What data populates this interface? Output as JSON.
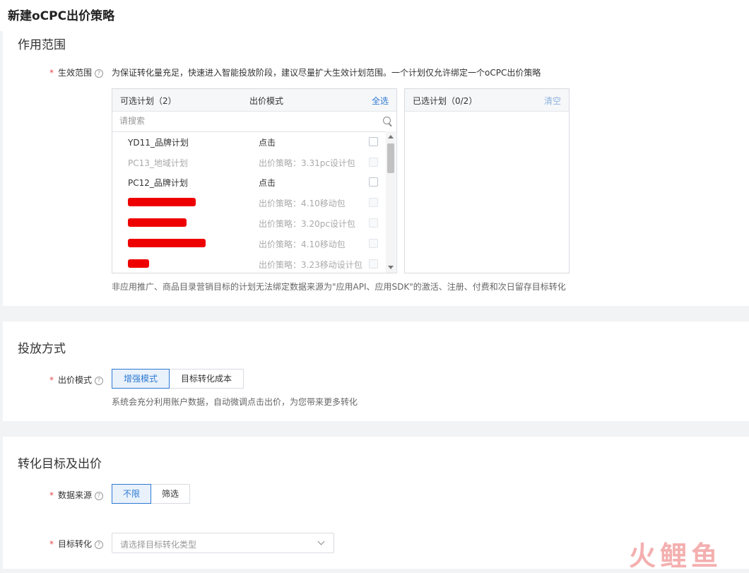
{
  "page": {
    "title": "新建oCPC出价策略"
  },
  "scope": {
    "section_title": "作用范围",
    "field_label": "生效范围",
    "field_hint": "为保证转化量充足，快速进入智能投放阶段，建议尽量扩大生效计划范围。一个计划仅允许绑定一个oCPC出价策略",
    "left_panel": {
      "header_plans": "可选计划（2）",
      "header_mode": "出价模式",
      "select_all": "全选",
      "search_placeholder": "请搜索",
      "rows": [
        {
          "name": "YD11_品牌计划",
          "mode": "点击"
        },
        {
          "name": "PC13_地域计划",
          "mode": "出价策略：3.31pc设计包"
        },
        {
          "name": "PC12_品牌计划",
          "mode": "点击"
        },
        {
          "name": "",
          "mode": "出价策略：4.10移动包"
        },
        {
          "name": "",
          "mode": "出价策略：3.20pc设计包"
        },
        {
          "name": "",
          "mode": "出价策略：4.10移动包"
        },
        {
          "name": "",
          "mode": "出价策略：3.23移动设计包"
        }
      ]
    },
    "right_panel": {
      "header": "已选计划（0/2）",
      "clear": "清空"
    },
    "footnote": "非应用推广、商品目录营销目标的计划无法绑定数据来源为\"应用API、应用SDK\"的激活、注册、付费和次日留存目标转化"
  },
  "delivery": {
    "section_title": "投放方式",
    "field_label": "出价模式",
    "options": [
      "增强模式",
      "目标转化成本"
    ],
    "selected": "增强模式",
    "hint": "系统会充分利用账户数据，自动微调点击出价，为您带来更多转化"
  },
  "conversion": {
    "section_title": "转化目标及出价",
    "source_label": "数据来源",
    "source_options": [
      "不限",
      "筛选"
    ],
    "source_selected": "不限",
    "target_label": "目标转化",
    "target_placeholder": "请选择目标转化类型"
  },
  "watermark": "火鲤鱼",
  "colors": {
    "accent": "#2d7ad3",
    "required": "#e5484d",
    "redaction": "#ee0000"
  }
}
